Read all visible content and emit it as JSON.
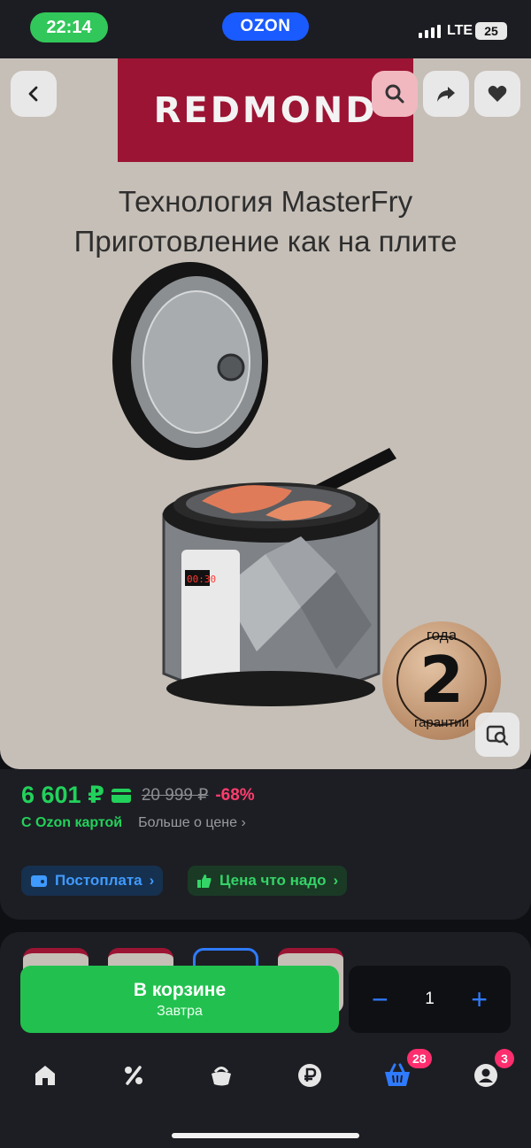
{
  "status_bar": {
    "time": "22:14",
    "app": "OZON",
    "network": "LTE",
    "battery": "25"
  },
  "product_image": {
    "brand": "REDMOND",
    "headline_1": "Технология MasterFry",
    "headline_2": "Приготовление как на плите",
    "guarantee": {
      "top": "года",
      "number": "2",
      "bottom": "гарантии"
    }
  },
  "price": {
    "current": "6 601 ₽",
    "old": "20 999 ₽",
    "discount": "-68%",
    "card_label": "С Ozon картой",
    "more_label": "Больше о цене",
    "chips": [
      {
        "label": "Постоплата",
        "icon": "wallet-icon"
      },
      {
        "label": "Цена что надо",
        "icon": "thumbs-up-icon"
      }
    ]
  },
  "cart": {
    "button_label": "В корзине",
    "button_sub": "Завтра",
    "quantity": "1"
  },
  "tabbar": {
    "items": [
      {
        "name": "home",
        "icon": "home-icon"
      },
      {
        "name": "deals",
        "icon": "percent-icon"
      },
      {
        "name": "fresh",
        "icon": "bag-icon"
      },
      {
        "name": "finance",
        "icon": "ruble-icon"
      },
      {
        "name": "cart",
        "icon": "basket-icon",
        "badge": "28"
      },
      {
        "name": "profile",
        "icon": "user-icon",
        "badge": "3"
      }
    ]
  },
  "colors": {
    "accent_green": "#22d15b",
    "accent_blue": "#2f7bff",
    "badge_pink": "#ff2e6e",
    "brand_red": "#9c1433"
  }
}
